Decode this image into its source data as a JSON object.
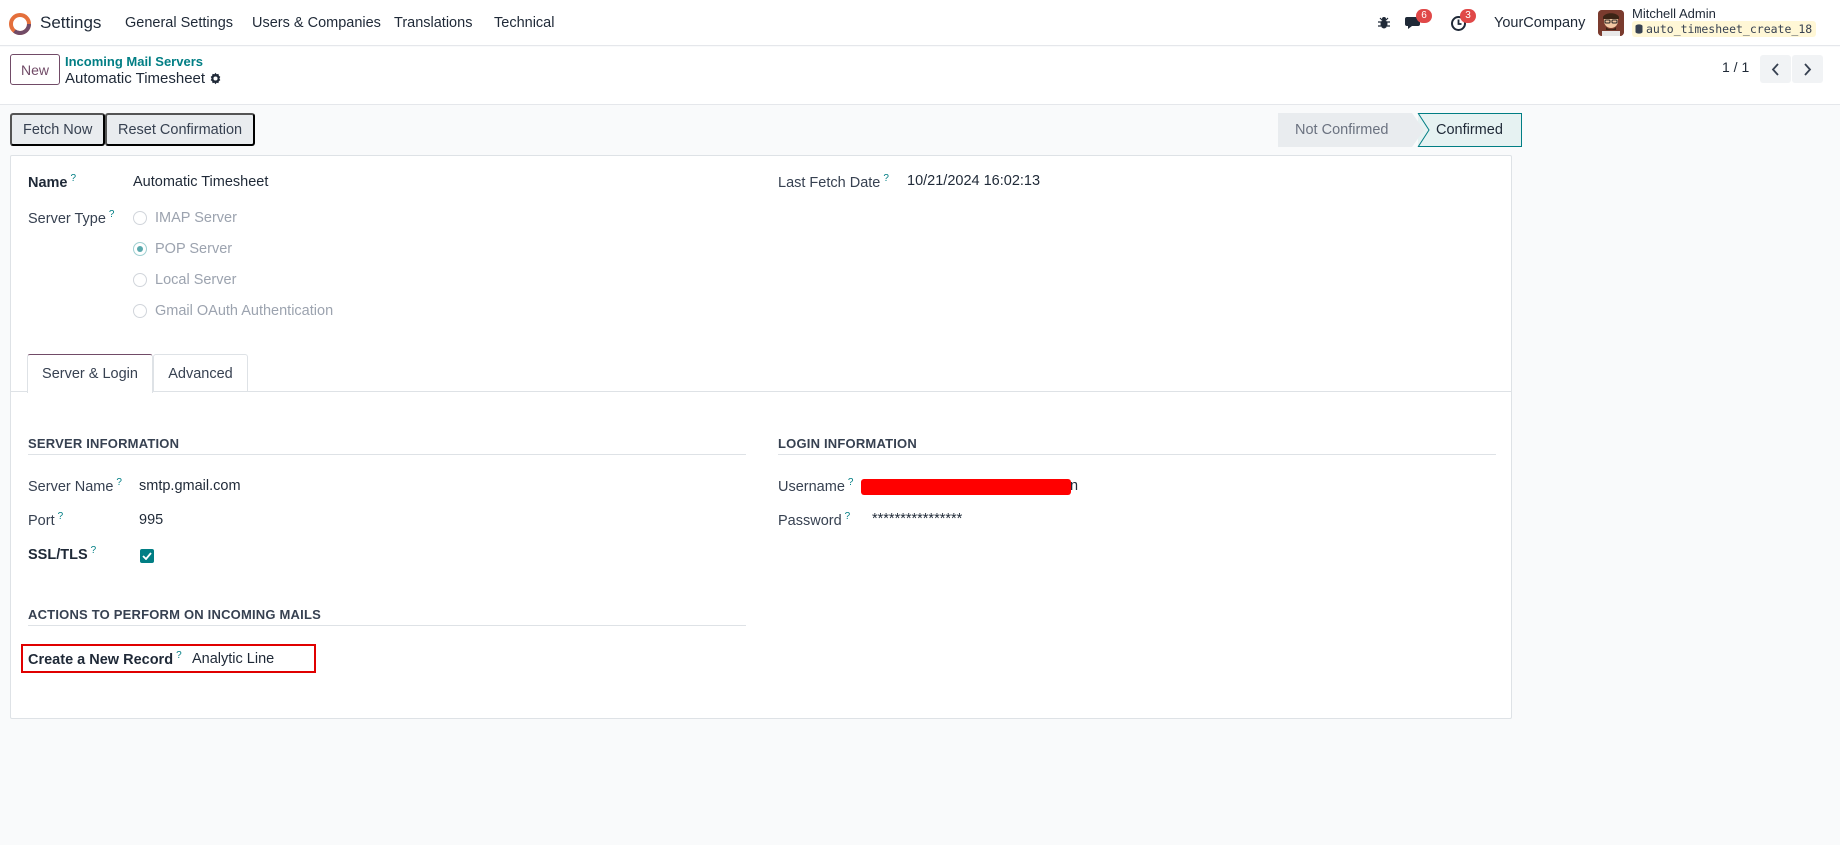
{
  "navbar": {
    "app_name": "Settings",
    "menu": [
      "General Settings",
      "Users & Companies",
      "Translations",
      "Technical"
    ],
    "messages_count": "6",
    "activities_count": "3",
    "company": "YourCompany",
    "user_name": "Mitchell Admin",
    "database": "auto_timesheet_create_18"
  },
  "control": {
    "new_label": "New",
    "breadcrumb_parent": "Incoming Mail Servers",
    "breadcrumb_current": "Automatic Timesheet",
    "pager": "1 / 1"
  },
  "actions": {
    "fetch_now": "Fetch Now",
    "reset_confirmation": "Reset Confirmation"
  },
  "status": {
    "stages": [
      "Not Confirmed",
      "Confirmed"
    ],
    "current": "Confirmed"
  },
  "form": {
    "name_label": "Name",
    "name_value": "Automatic Timesheet",
    "last_fetch_label": "Last Fetch Date",
    "last_fetch_value": "10/21/2024 16:02:13",
    "server_type_label": "Server Type",
    "server_types": [
      "IMAP Server",
      "POP Server",
      "Local Server",
      "Gmail OAuth Authentication"
    ],
    "server_type_selected": "POP Server",
    "tabs": [
      "Server & Login",
      "Advanced"
    ],
    "active_tab": "Server & Login",
    "server_info_title": "SERVER INFORMATION",
    "server_name_label": "Server Name",
    "server_name_value": "smtp.gmail.com",
    "port_label": "Port",
    "port_value": "995",
    "ssl_label": "SSL/TLS",
    "ssl_checked": true,
    "login_info_title": "LOGIN INFORMATION",
    "username_label": "Username",
    "username_tail": "n",
    "password_label": "Password",
    "password_value": "****************",
    "actions_title": "ACTIONS TO PERFORM ON INCOMING MAILS",
    "create_record_label": "Create a New Record",
    "create_record_value": "Analytic Line"
  },
  "colors": {
    "brand": "#714b67",
    "accent": "#017e84",
    "highlight": "#e00000"
  }
}
